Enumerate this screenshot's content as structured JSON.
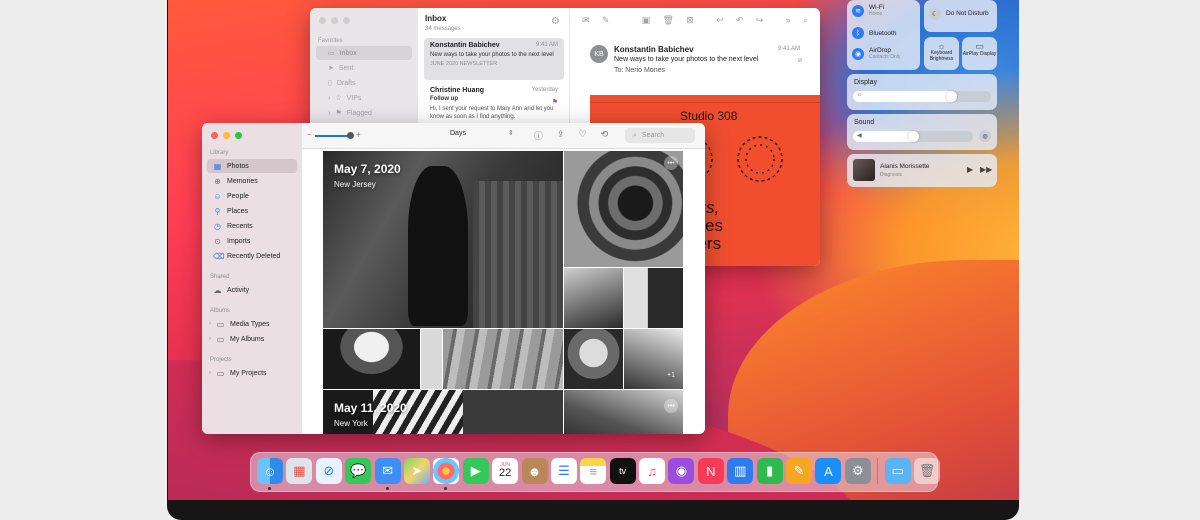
{
  "mail": {
    "sidebar_section": "Favorites",
    "mailboxes": [
      "Inbox",
      "Sent",
      "Drafts",
      "VIPs",
      "Flagged"
    ],
    "list_title": "Inbox",
    "list_count": "34 messages",
    "messages": [
      {
        "from": "Konstantin Babichev",
        "time": "9:41 AM",
        "subject": "New ways to take your photos to the next level",
        "tag": "JUNE 2020 NEWSLETTER"
      },
      {
        "from": "Christine Huang",
        "time": "Yesterday",
        "subject": "Follow up",
        "preview": "Hi, I sent your request to Mary Ann and let you know as soon as I find anything."
      }
    ],
    "reader": {
      "initials": "KB",
      "from": "Konstantin Babichev",
      "time": "9:41 AM",
      "subject": "New ways to take your photos to the next level",
      "to_label": "To:",
      "to": "Nerio Mones",
      "poster_studio": "Studio 308",
      "poster_line1": "g Focus,",
      "poster_line2": "op series",
      "poster_line3": "graphers"
    }
  },
  "photos": {
    "library_label": "Library",
    "library_items": [
      "Photos",
      "Memories",
      "People",
      "Places",
      "Recents",
      "Imports",
      "Recently Deleted"
    ],
    "shared_label": "Shared",
    "shared_items": [
      "Activity"
    ],
    "albums_label": "Albums",
    "album_items": [
      "Media Types",
      "My Albums"
    ],
    "projects_label": "Projects",
    "project_items": [
      "My Projects"
    ],
    "view_select": "Days",
    "search_placeholder": "Search",
    "day1_date": "May 7, 2020",
    "day1_place": "New Jersey",
    "day2_date": "May 11, 2020",
    "day2_place": "New York",
    "extra_count": "+1"
  },
  "control_center": {
    "wifi": "Wi-Fi",
    "wifi_sub": "Home",
    "bluetooth": "Bluetooth",
    "airdrop": "AirDrop",
    "airdrop_sub": "Contacts Only",
    "dnd": "Do Not Disturb",
    "keyboard": "Keyboard Brightness",
    "airplay": "AirPlay Display",
    "display_label": "Display",
    "display_level": 0.75,
    "sound_label": "Sound",
    "sound_level": 0.55,
    "now_playing_artist": "Alanis Morissette",
    "now_playing_track": "Diagnosis"
  },
  "dock": {
    "icons": [
      "finder-icon",
      "launchpad-icon",
      "safari-icon",
      "messages-icon",
      "mail-icon",
      "maps-icon",
      "photos-icon",
      "facetime-icon",
      "calendar-icon",
      "contacts-icon",
      "reminders-icon",
      "notes-icon",
      "tv-icon",
      "music-icon",
      "podcasts-icon",
      "news-icon",
      "keynote-icon",
      "numbers-icon",
      "pages-icon",
      "app-store-icon",
      "system-preferences-icon",
      "downloads-folder-icon",
      "trash-icon"
    ],
    "calendar_month": "JUN",
    "calendar_day": "22"
  }
}
